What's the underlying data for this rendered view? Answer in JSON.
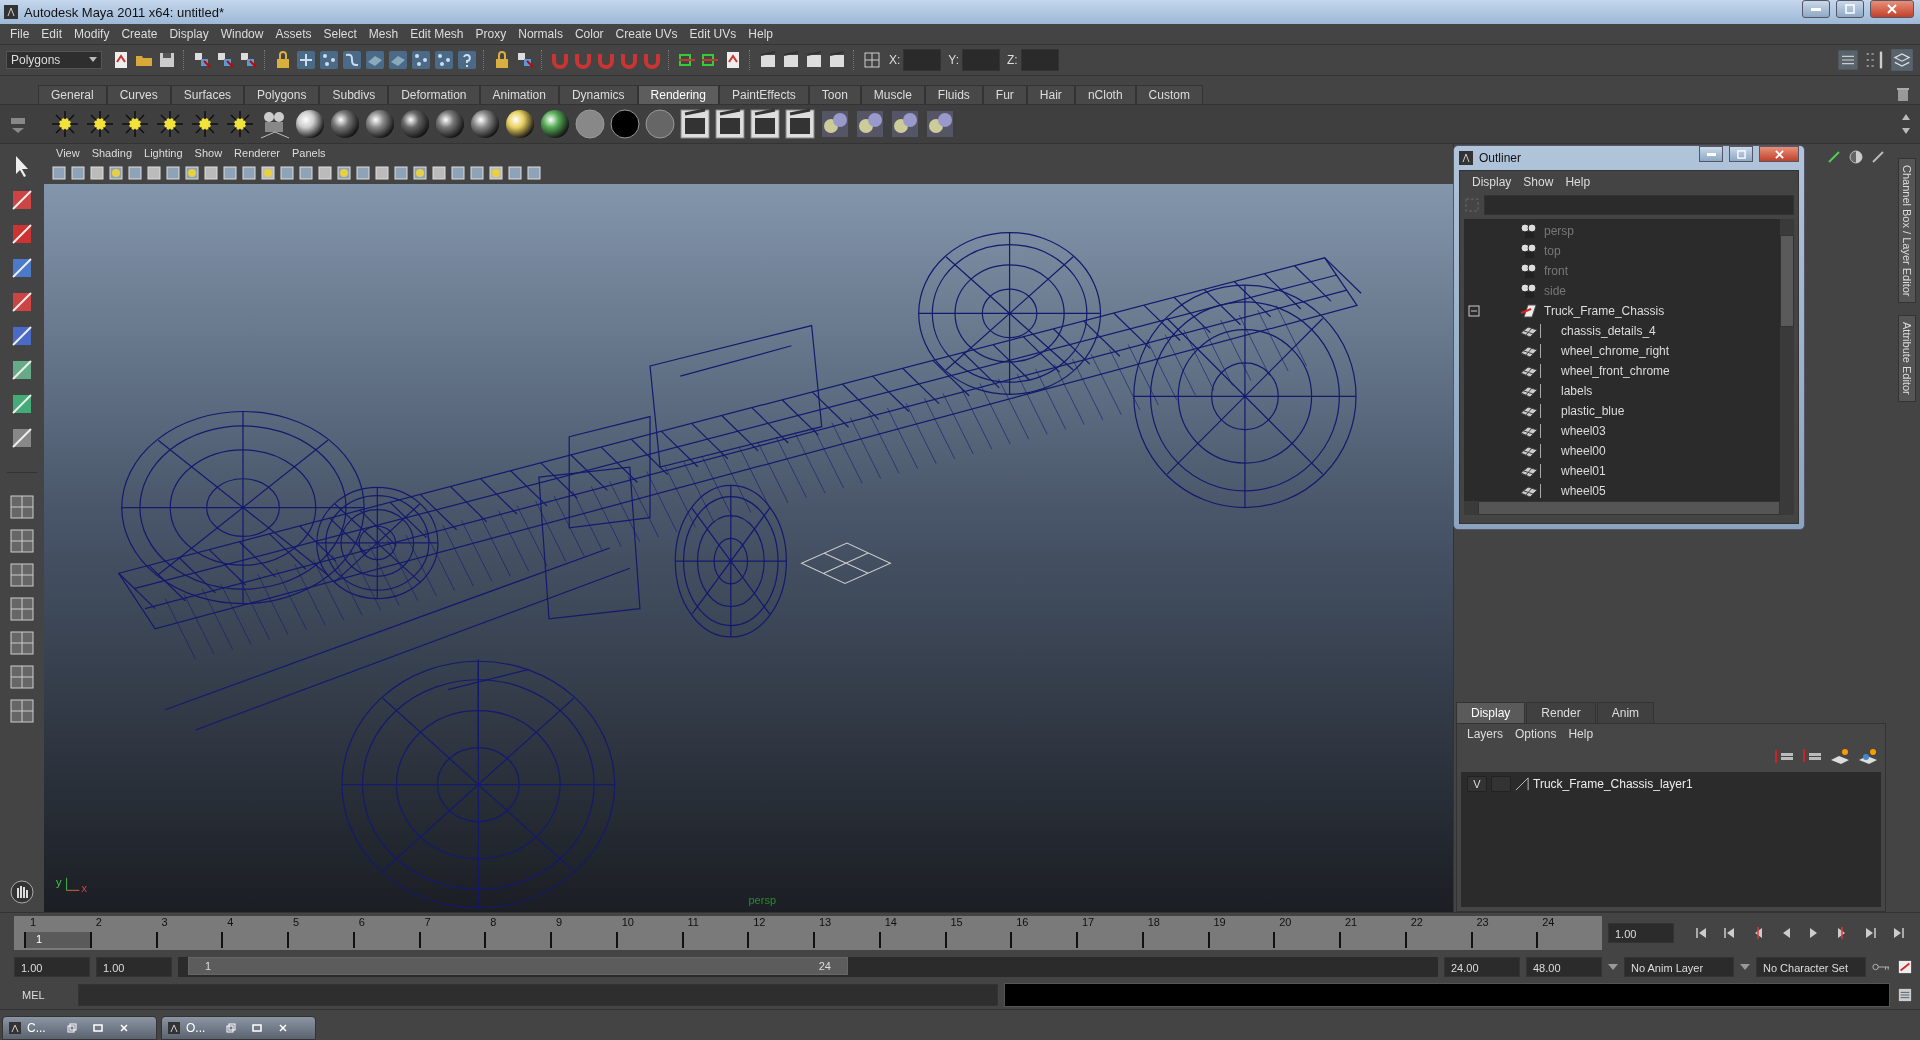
{
  "window": {
    "title": "Autodesk Maya 2011 x64: untitled*"
  },
  "menu_bar": [
    "File",
    "Edit",
    "Modify",
    "Create",
    "Display",
    "Window",
    "Assets",
    "Select",
    "Mesh",
    "Edit Mesh",
    "Proxy",
    "Normals",
    "Color",
    "Create UVs",
    "Edit UVs",
    "Help"
  ],
  "status_line": {
    "mode": "Polygons",
    "coordinate_labels": [
      "X:",
      "Y:",
      "Z:"
    ]
  },
  "shelf": {
    "tabs": [
      {
        "label": "General",
        "selected": false
      },
      {
        "label": "Curves",
        "selected": false
      },
      {
        "label": "Surfaces",
        "selected": false
      },
      {
        "label": "Polygons",
        "selected": false
      },
      {
        "label": "Subdivs",
        "selected": false
      },
      {
        "label": "Deformation",
        "selected": false
      },
      {
        "label": "Animation",
        "selected": false
      },
      {
        "label": "Dynamics",
        "selected": false
      },
      {
        "label": "Rendering",
        "selected": true
      },
      {
        "label": "PaintEffects",
        "selected": false
      },
      {
        "label": "Toon",
        "selected": false
      },
      {
        "label": "Muscle",
        "selected": false
      },
      {
        "label": "Fluids",
        "selected": false
      },
      {
        "label": "Fur",
        "selected": false
      },
      {
        "label": "Hair",
        "selected": false
      },
      {
        "label": "nCloth",
        "selected": false
      },
      {
        "label": "Custom",
        "selected": false
      }
    ]
  },
  "viewport": {
    "menu": [
      "View",
      "Shading",
      "Lighting",
      "Show",
      "Renderer",
      "Panels"
    ],
    "camera_label": "persp",
    "axis_labels": [
      "y",
      "x"
    ]
  },
  "outliner": {
    "title": "Outliner",
    "menu": [
      "Display",
      "Show",
      "Help"
    ],
    "items": [
      {
        "name": "persp",
        "kind": "camera"
      },
      {
        "name": "top",
        "kind": "camera"
      },
      {
        "name": "front",
        "kind": "camera"
      },
      {
        "name": "side",
        "kind": "camera"
      },
      {
        "name": "Truck_Frame_Chassis",
        "kind": "group",
        "expanded": true,
        "children": [
          {
            "name": "chassis_details_4",
            "kind": "mesh"
          },
          {
            "name": "wheel_chrome_right",
            "kind": "mesh"
          },
          {
            "name": "wheel_front_chrome",
            "kind": "mesh"
          },
          {
            "name": "labels",
            "kind": "mesh"
          },
          {
            "name": "plastic_blue",
            "kind": "mesh"
          },
          {
            "name": "wheel03",
            "kind": "mesh"
          },
          {
            "name": "wheel00",
            "kind": "mesh"
          },
          {
            "name": "wheel01",
            "kind": "mesh"
          },
          {
            "name": "wheel05",
            "kind": "mesh"
          }
        ]
      }
    ]
  },
  "side_tabs": [
    "Channel Box / Layer Editor",
    "Attribute Editor"
  ],
  "layer_editor": {
    "tabs": [
      {
        "label": "Display",
        "selected": true
      },
      {
        "label": "Render",
        "selected": false
      },
      {
        "label": "Anim",
        "selected": false
      }
    ],
    "menu": [
      "Layers",
      "Options",
      "Help"
    ],
    "layers": [
      {
        "visibility": "V",
        "name": "Truck_Frame_Chassis_layer1"
      }
    ]
  },
  "timeline": {
    "frames": [
      {
        "label": "1",
        "selected": true
      },
      {
        "label": "2",
        "selected": false
      },
      {
        "label": "3",
        "selected": false
      },
      {
        "label": "4",
        "selected": false
      },
      {
        "label": "5",
        "selected": false
      },
      {
        "label": "6",
        "selected": false
      },
      {
        "label": "7",
        "selected": false
      },
      {
        "label": "8",
        "selected": false
      },
      {
        "label": "9",
        "selected": false
      },
      {
        "label": "10",
        "selected": false
      },
      {
        "label": "11",
        "selected": false
      },
      {
        "label": "12",
        "selected": false
      },
      {
        "label": "13",
        "selected": false
      },
      {
        "label": "14",
        "selected": false
      },
      {
        "label": "15",
        "selected": false
      },
      {
        "label": "16",
        "selected": false
      },
      {
        "label": "17",
        "selected": false
      },
      {
        "label": "18",
        "selected": false
      },
      {
        "label": "19",
        "selected": false
      },
      {
        "label": "20",
        "selected": false
      },
      {
        "label": "21",
        "selected": false
      },
      {
        "label": "22",
        "selected": false
      },
      {
        "label": "23",
        "selected": false
      },
      {
        "label": "24",
        "selected": false
      }
    ],
    "current_frame": "1",
    "current_time": "1.00"
  },
  "range": {
    "start": "1.00",
    "playback_start": "1.00",
    "slider_start": "1",
    "slider_end": "24",
    "playback_end": "24.00",
    "end": "48.00",
    "anim_layer": "No Anim Layer",
    "character_set": "No Character Set"
  },
  "command_line": {
    "label": "MEL"
  },
  "taskbar": [
    {
      "label": "C..."
    },
    {
      "label": "O..."
    }
  ]
}
